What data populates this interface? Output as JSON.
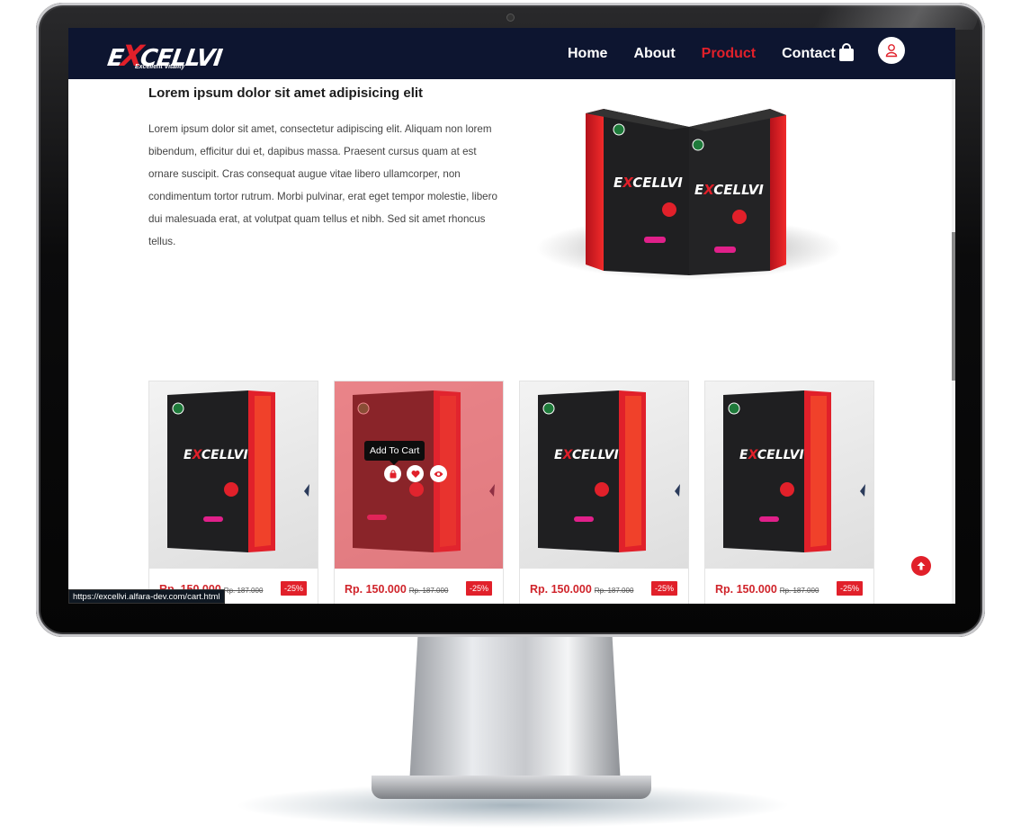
{
  "brand": {
    "logo_text_pre": "E",
    "logo_text_x": "X",
    "logo_text_post": "CELLVI",
    "tagline": "Excellent Vitality"
  },
  "nav": {
    "items": [
      {
        "label": "Home"
      },
      {
        "label": "About"
      },
      {
        "label": "Product"
      },
      {
        "label": "Contact"
      }
    ],
    "active": "Product"
  },
  "hero": {
    "heading": "Lorem ipsum dolor sit amet adipisicing elit",
    "paragraph": "Lorem ipsum dolor sit amet, consectetur adipiscing elit. Aliquam non lorem bibendum, efficitur dui et, dapibus massa. Praesent cursus quam at est ornare suscipit. Cras consequat augue vitae libero ullamcorper, non condimentum tortor rutrum. Morbi pulvinar, erat eget tempor molestie, libero dui malesuada erat, at volutpat quam tellus et nibh. Sed sit amet rhoncus tellus."
  },
  "products": [
    {
      "price": "Rp. 150.000",
      "old_price": "Rp. 187.000",
      "discount": "-25%"
    },
    {
      "price": "Rp. 150.000",
      "old_price": "Rp. 187.000",
      "discount": "-25%",
      "hovered": true,
      "tooltip": "Add To Cart"
    },
    {
      "price": "Rp. 150.000",
      "old_price": "Rp. 187.000",
      "discount": "-25%"
    },
    {
      "price": "Rp. 150.000",
      "old_price": "Rp. 187.000",
      "discount": "-25%"
    }
  ],
  "status_bar": {
    "url": "https://excellvi.alfara-dev.com/cart.html"
  },
  "icons": {
    "cart": "shopping-bag-icon",
    "user": "user-icon",
    "scroll_top": "arrow-up-circle-icon",
    "add_to_cart": "bag-icon",
    "wishlist": "heart-icon",
    "quick_view": "eye-icon"
  },
  "colors": {
    "navbar": "#0d1530",
    "accent": "#e1202a",
    "price": "#d0242b"
  }
}
